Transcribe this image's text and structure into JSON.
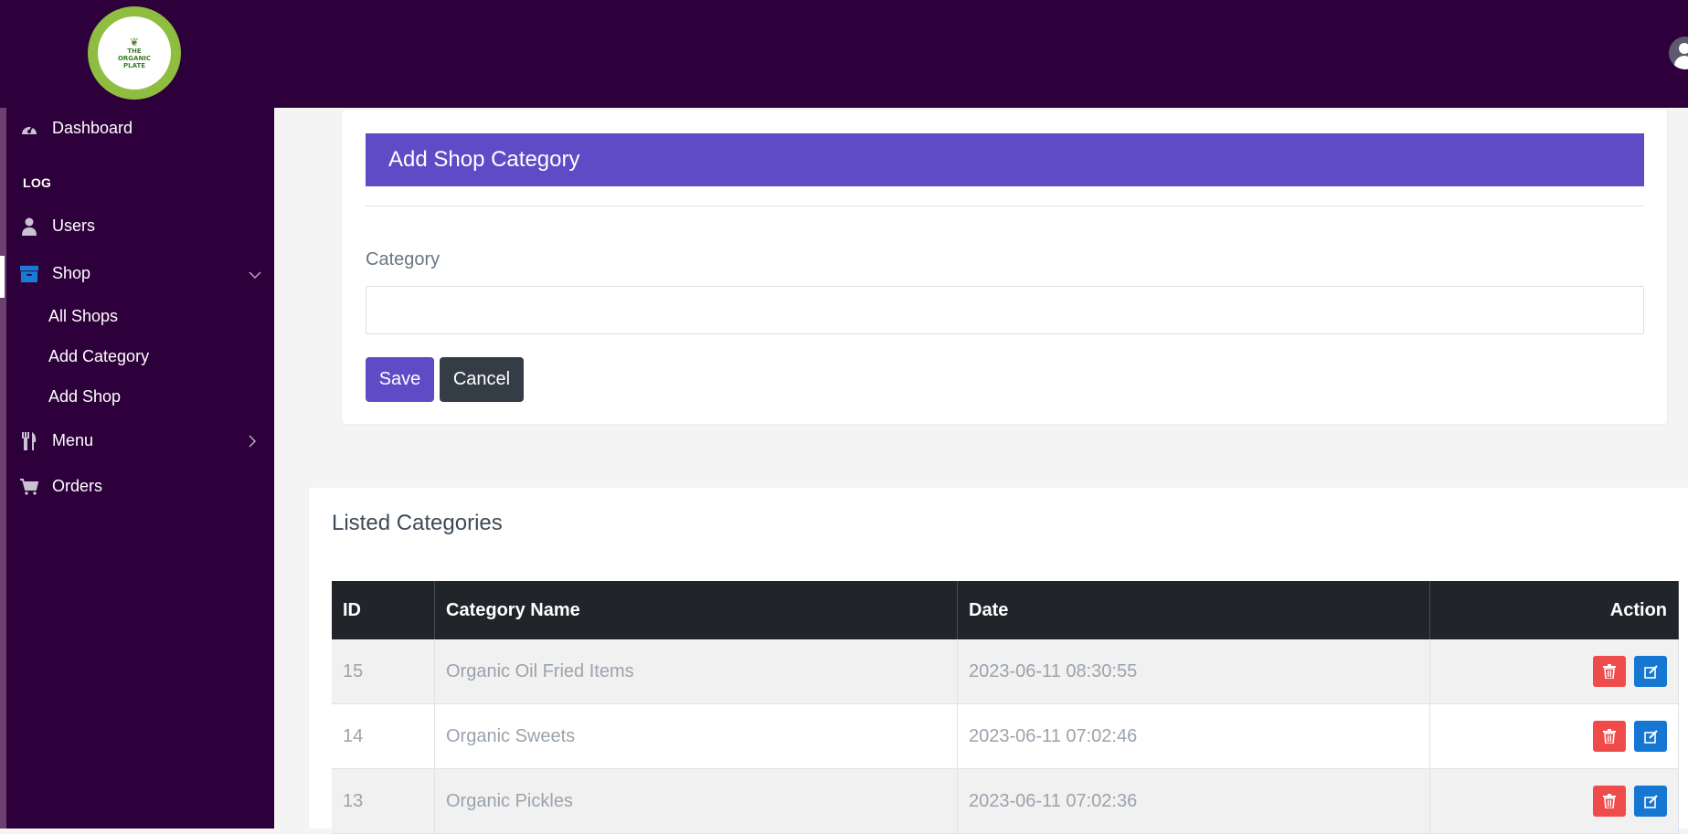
{
  "brand": {
    "logo_text": [
      "THE",
      "ORGANIC",
      "PLATE"
    ]
  },
  "sidebar": {
    "items": [
      {
        "label": "Dashboard",
        "icon": "gauge-icon"
      },
      {
        "heading": "LOG"
      },
      {
        "label": "Users",
        "icon": "user-icon"
      },
      {
        "label": "Shop",
        "icon": "archive-box-icon",
        "expanded": true,
        "children": [
          "All Shops",
          "Add Category",
          "Add Shop"
        ]
      },
      {
        "label": "Menu",
        "icon": "utensils-icon"
      },
      {
        "label": "Orders",
        "icon": "cart-icon"
      }
    ]
  },
  "form": {
    "title": "Add Shop Category",
    "field_label": "Category",
    "field_value": "",
    "save_label": "Save",
    "cancel_label": "Cancel"
  },
  "listing": {
    "title": "Listed Categories",
    "columns": [
      "ID",
      "Category Name",
      "Date",
      "Action"
    ],
    "rows": [
      {
        "id": "15",
        "name": "Organic Oil Fried Items",
        "date": "2023-06-11 08:30:55"
      },
      {
        "id": "14",
        "name": "Organic Sweets",
        "date": "2023-06-11 07:02:46"
      },
      {
        "id": "13",
        "name": "Organic Pickles",
        "date": "2023-06-11 07:02:36"
      }
    ]
  },
  "colors": {
    "topbar": "#2e003b",
    "accent": "#5f4bc6",
    "delete": "#ef4b4b",
    "edit": "#1677d2"
  }
}
